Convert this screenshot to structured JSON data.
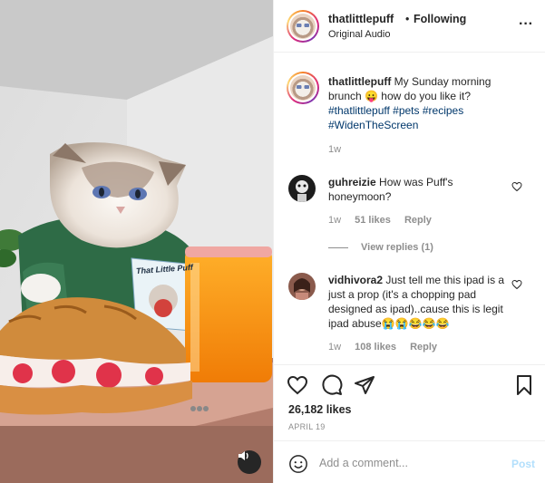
{
  "header": {
    "username": "thatlittlepuff",
    "separator": "•",
    "follow_status": "Following",
    "audio": "Original Audio",
    "more_icon": "more-horizontal-icon"
  },
  "media": {
    "mug_label": "That Little Puff",
    "audio_icon": "speaker-icon"
  },
  "caption": {
    "username": "thatlittlepuff",
    "text": "My Sunday morning brunch 😛 how do you like it?",
    "hashtags": "#thatlittlepuff #pets #recipes #WidenTheScreen",
    "time": "1w"
  },
  "comments": [
    {
      "username": "guhreizie",
      "text": "How was Puff's honeymoon?",
      "time": "1w",
      "likes": "51 likes",
      "reply": "Reply",
      "view_replies": "View replies (1)"
    },
    {
      "username": "vidhivora2",
      "text": "Just tell me this ipad is a just a prop (it's a chopping pad designed as ipad)..cause this is legit ipad abuse😭😭😂😂😂",
      "time": "1w",
      "likes": "108 likes",
      "reply": "Reply"
    }
  ],
  "actions": {
    "like_icon": "heart-icon",
    "comment_icon": "comment-icon",
    "share_icon": "paper-plane-icon",
    "save_icon": "bookmark-icon",
    "likes": "26,182 likes",
    "date": "APRIL 19"
  },
  "add_comment": {
    "placeholder": "Add a comment...",
    "post_label": "Post",
    "emoji_icon": "smiley-icon"
  },
  "colors": {
    "link": "#00376b",
    "muted": "#8e8e8e",
    "post_disabled": "#b2dffc",
    "text": "#262626"
  }
}
